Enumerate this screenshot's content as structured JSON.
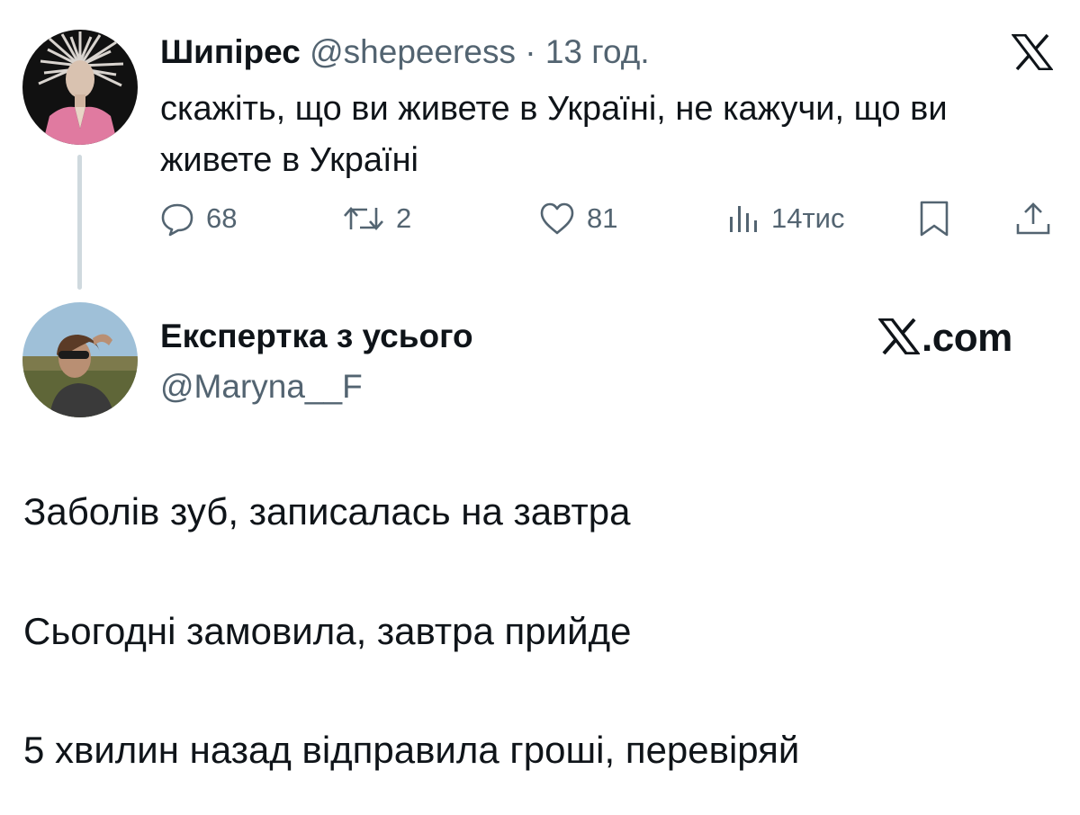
{
  "tweet": {
    "author_name": "Шипірес",
    "handle": "@shepeeress",
    "separator": "·",
    "time": "13 год.",
    "text": "скажіть, що ви живете в Україні, не кажучи, що ви живете в Україні",
    "stats": {
      "replies": "68",
      "retweets": "2",
      "likes": "81",
      "views": "14тис"
    },
    "icons": [
      "x-logo-icon",
      "reply-icon",
      "retweet-icon",
      "like-icon",
      "views-icon",
      "bookmark-icon",
      "share-icon"
    ]
  },
  "reply": {
    "author_name": "Експертка з усього",
    "handle": "@Maryna__F",
    "brand": ".com",
    "lines": [
      "Заболів зуб, записалась на завтра",
      "Сьогодні замовила, завтра прийде",
      "5 хвилин назад відправила гроші, перевіряй"
    ]
  },
  "colors": {
    "text": "#0f1419",
    "secondary": "#536471",
    "thread_line": "#cfd9de",
    "background": "#ffffff"
  }
}
